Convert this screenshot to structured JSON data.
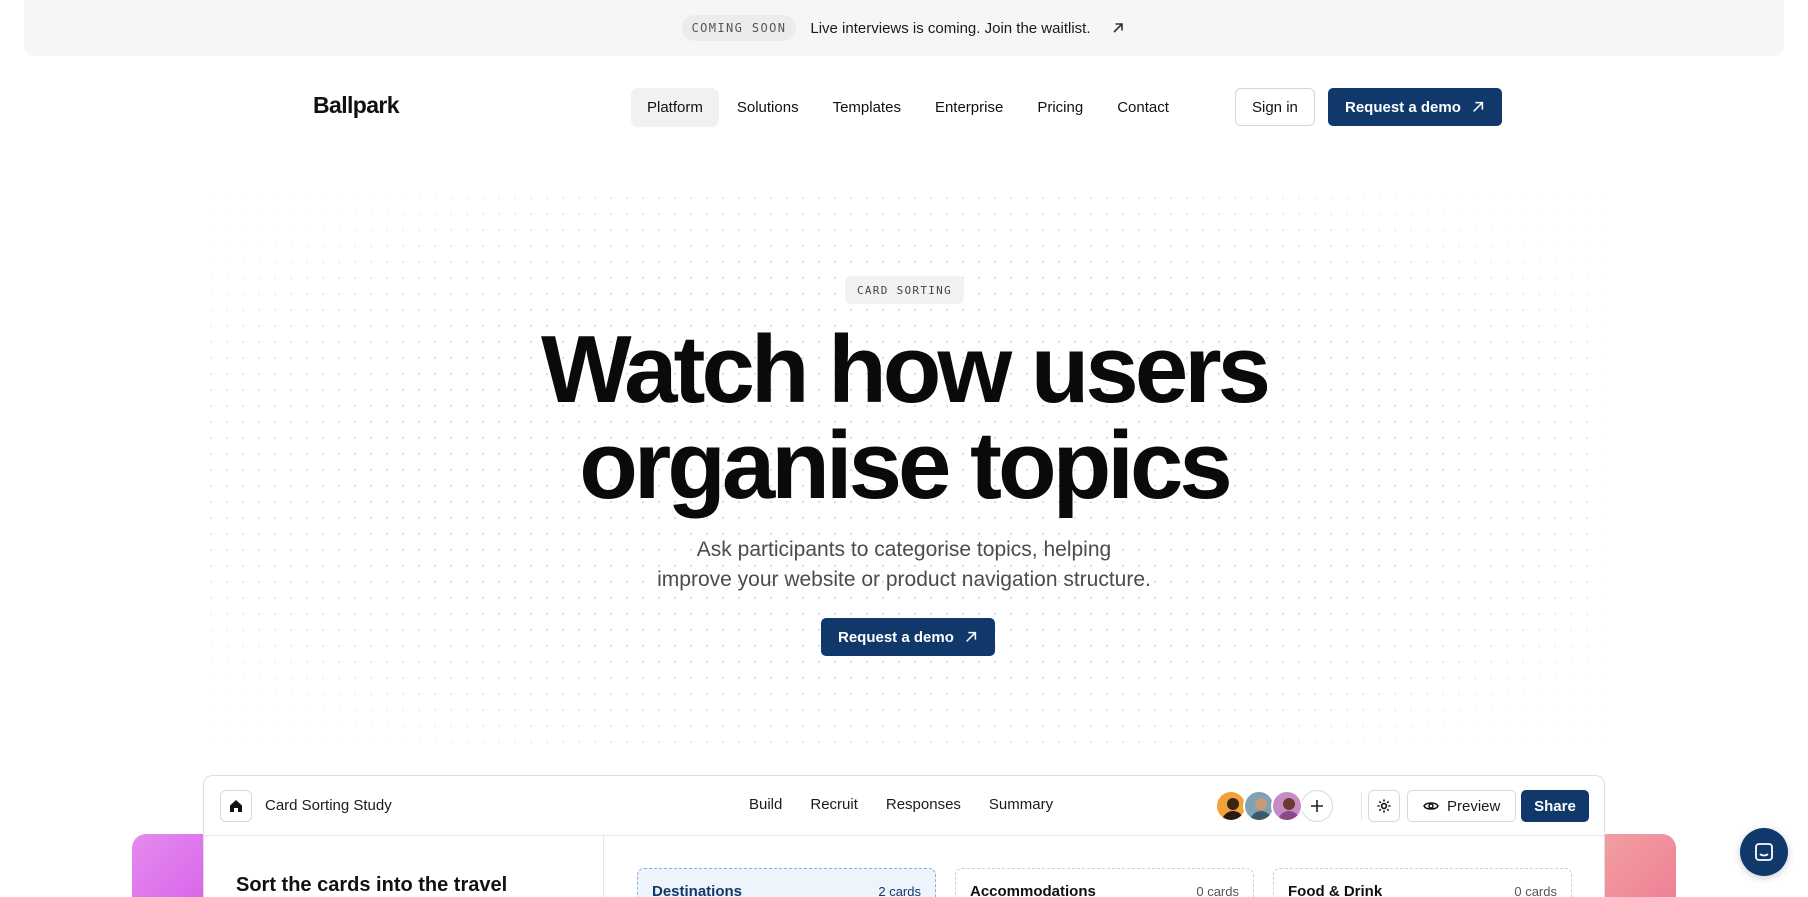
{
  "announcement": {
    "tag": "COMING SOON",
    "message": "Live interviews is coming. Join the waitlist.",
    "arrow_icon": "arrow-up-right-icon"
  },
  "nav": {
    "logo": "Ballpark",
    "items": [
      {
        "label": "Platform",
        "active": true
      },
      {
        "label": "Solutions"
      },
      {
        "label": "Templates"
      },
      {
        "label": "Enterprise"
      },
      {
        "label": "Pricing"
      },
      {
        "label": "Contact"
      }
    ],
    "signin_label": "Sign in",
    "demo_label": "Request a demo"
  },
  "hero": {
    "tag": "CARD SORTING",
    "title_line1": "Watch how users",
    "title_line2": "organise topics",
    "subtitle_line1": "Ask participants to categorise topics, helping",
    "subtitle_line2": "improve your website or product navigation structure.",
    "cta_label": "Request a demo"
  },
  "app_preview": {
    "study_name": "Card Sorting Study",
    "tabs": [
      "Build",
      "Recruit",
      "Responses",
      "Summary"
    ],
    "preview_label": "Preview",
    "share_label": "Share",
    "question": "Sort the cards into the travel",
    "categories": [
      {
        "name": "Destinations",
        "count": "2 cards"
      },
      {
        "name": "Accommodations",
        "count": "0 cards"
      },
      {
        "name": "Food & Drink",
        "count": "0 cards"
      }
    ]
  },
  "colors": {
    "primary": "#10386b",
    "gradient_left": "#d65fe8",
    "gradient_right": "#ec7e93"
  }
}
